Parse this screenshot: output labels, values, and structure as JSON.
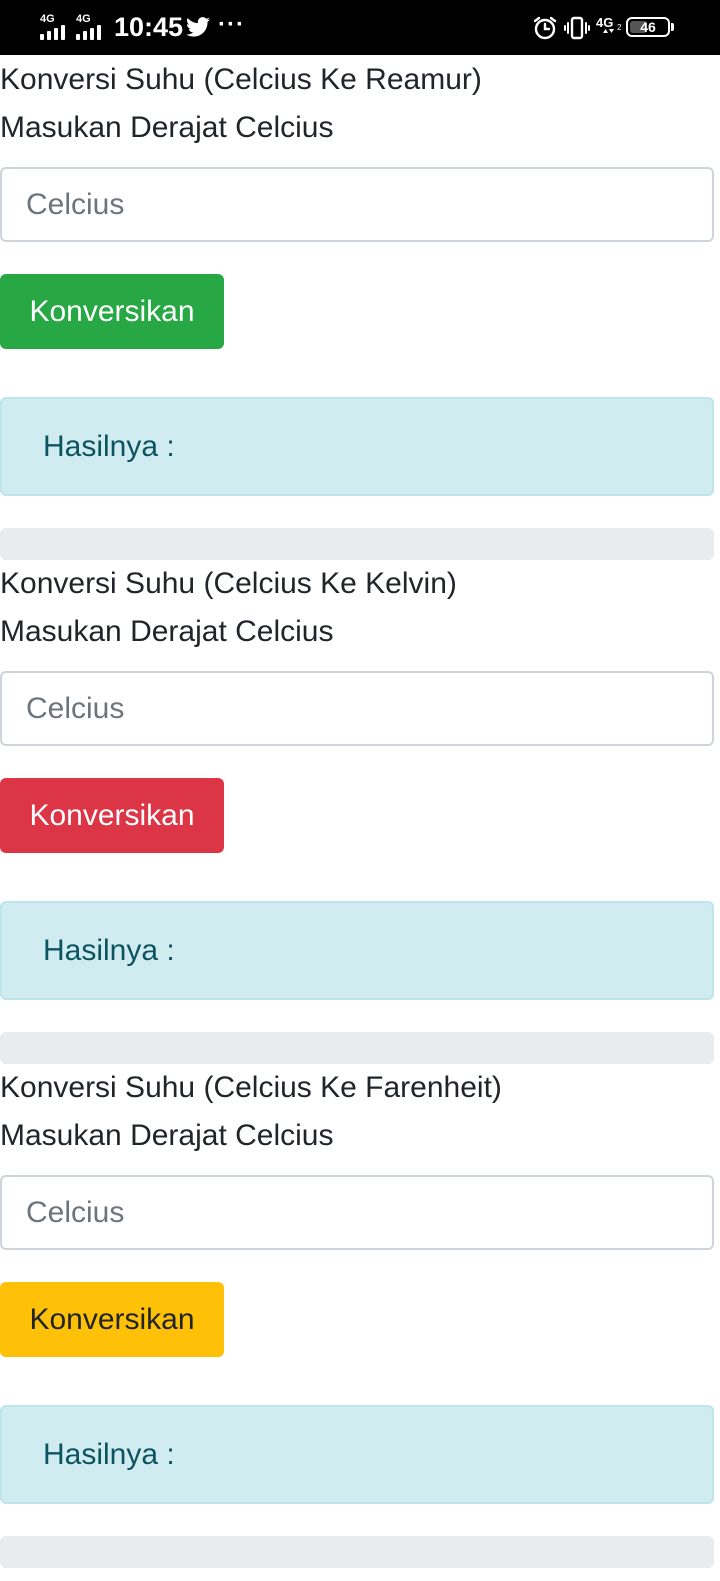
{
  "status_bar": {
    "signal_1": "4G",
    "signal_2": "4G",
    "time": "10:45",
    "more": "···",
    "network": "4G",
    "battery": "46",
    "battery_level": 46,
    "icons": [
      "twitter-icon",
      "alarm-icon",
      "vibrate-icon",
      "4g-icon",
      "battery-icon"
    ]
  },
  "sections": [
    {
      "title": "Konversi Suhu (Celcius Ke Reamur)",
      "label": "Masukan Derajat Celcius",
      "input": {
        "value": "",
        "placeholder": "Celcius"
      },
      "button": "Konversikan",
      "button_color": "#28a745",
      "result": "Hasilnya :"
    },
    {
      "title": "Konversi Suhu (Celcius Ke Kelvin)",
      "label": "Masukan Derajat Celcius",
      "input": {
        "value": "",
        "placeholder": "Celcius"
      },
      "button": "Konversikan",
      "button_color": "#dc3545",
      "result": "Hasilnya :"
    },
    {
      "title": "Konversi Suhu (Celcius Ke Farenheit)",
      "label": "Masukan Derajat Celcius",
      "input": {
        "value": "",
        "placeholder": "Celcius"
      },
      "button": "Konversikan",
      "button_color": "#ffc107",
      "result": "Hasilnya :"
    }
  ],
  "colors": {
    "result_bg": "#d1ecf1",
    "result_text": "#0c5460",
    "divider": "#e9ecef"
  }
}
